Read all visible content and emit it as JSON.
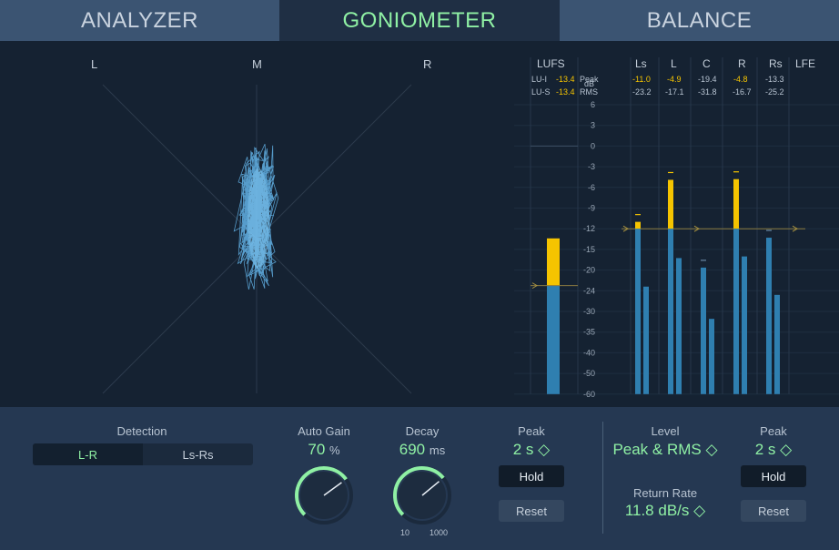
{
  "tabs": [
    {
      "label": "ANALYZER",
      "active": false
    },
    {
      "label": "GONIOMETER",
      "active": true
    },
    {
      "label": "BALANCE",
      "active": false
    }
  ],
  "goniometer": {
    "left_label": "L",
    "mid_label": "M",
    "right_label": "R"
  },
  "meters": {
    "lufs_label": "LUFS",
    "lui_label": "LU-I",
    "lui_value": "-13.4",
    "lus_label": "LU-S",
    "lus_value": "-13.4",
    "db_label": "dB",
    "peak_label": "Peak",
    "rms_label": "RMS",
    "scale": [
      "6",
      "3",
      "0",
      "-3",
      "-6",
      "-9",
      "-12",
      "-15",
      "-20",
      "-24",
      "-30",
      "-35",
      "-40",
      "-50",
      "-60"
    ],
    "channels": [
      {
        "name": "Ls",
        "peak": "-11.0",
        "rms": "-23.2",
        "peak_hot": true,
        "peak_db": -11.0,
        "rms_db": -23.2
      },
      {
        "name": "L",
        "peak": "-4.9",
        "rms": "-17.1",
        "peak_hot": true,
        "peak_db": -4.9,
        "rms_db": -17.1
      },
      {
        "name": "C",
        "peak": "-19.4",
        "rms": "-31.8",
        "peak_hot": false,
        "peak_db": -19.4,
        "rms_db": -31.8
      },
      {
        "name": "R",
        "peak": "-4.8",
        "rms": "-16.7",
        "peak_hot": true,
        "peak_db": -4.8,
        "rms_db": -16.7
      },
      {
        "name": "Rs",
        "peak": "-13.3",
        "rms": "-25.2",
        "peak_hot": false,
        "peak_db": -13.3,
        "rms_db": -25.2
      },
      {
        "name": "LFE",
        "peak": "",
        "rms": "",
        "peak_hot": false
      }
    ]
  },
  "panel": {
    "detection_label": "Detection",
    "detection_options": [
      "L-R",
      "Ls-Rs"
    ],
    "autogain_label": "Auto Gain",
    "autogain_value": "70",
    "autogain_unit": "%",
    "autogain_level": 0.7,
    "decay_label": "Decay",
    "decay_value": "690",
    "decay_unit": "ms",
    "decay_min": "10",
    "decay_max": "1000",
    "peak_label_left": "Peak",
    "peak_value_left": "2 s ◇",
    "hold_label": "Hold",
    "reset_label": "Reset",
    "level_label": "Level",
    "level_value": "Peak & RMS ◇",
    "return_rate_label": "Return Rate",
    "return_rate_value": "11.8 dB/s ◇",
    "peak_label_right": "Peak",
    "peak_value_right": "2 s ◇"
  },
  "colors": {
    "accent": "#8ff0a4",
    "meter_blue": "#2f7fb0",
    "meter_yellow": "#f5c400",
    "trace": "#6cc6ff"
  }
}
